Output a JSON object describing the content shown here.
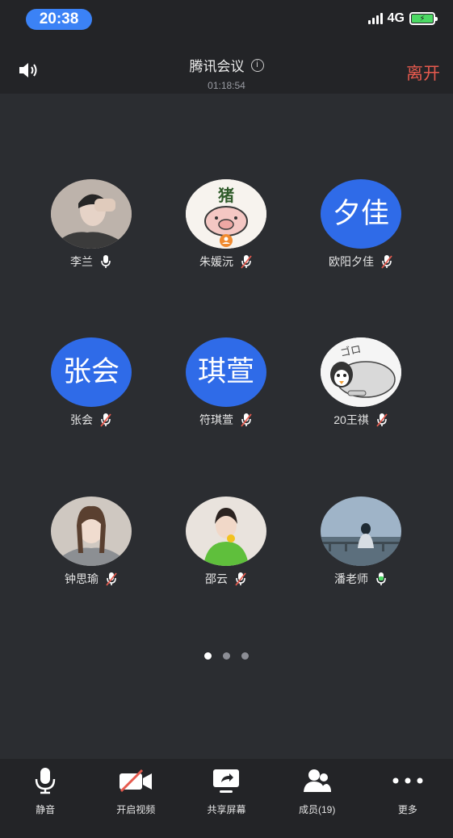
{
  "status": {
    "time": "20:38",
    "network": "4G"
  },
  "header": {
    "title": "腾讯会议",
    "duration": "01:18:54",
    "leave_label": "离开"
  },
  "members": [
    {
      "name": "李兰",
      "avatar_type": "photo",
      "mic": "on"
    },
    {
      "name": "朱媛沅",
      "avatar_type": "photo",
      "mic": "muted",
      "avatar_text": "猪"
    },
    {
      "name": "欧阳夕佳",
      "avatar_type": "text",
      "avatar_text": "夕佳",
      "mic": "muted"
    },
    {
      "name": "张会",
      "avatar_type": "text",
      "avatar_text": "张会",
      "mic": "muted"
    },
    {
      "name": "符琪萱",
      "avatar_type": "text",
      "avatar_text": "琪萱",
      "mic": "muted"
    },
    {
      "name": "20王祺",
      "avatar_type": "photo",
      "mic": "muted",
      "avatar_text": "ゴロ"
    },
    {
      "name": "钟思瑜",
      "avatar_type": "photo",
      "mic": "muted"
    },
    {
      "name": "邵云",
      "avatar_type": "photo",
      "mic": "muted"
    },
    {
      "name": "潘老师",
      "avatar_type": "photo",
      "mic": "active"
    }
  ],
  "toolbar": [
    {
      "label": "静音",
      "icon": "microphone-icon"
    },
    {
      "label": "开启视频",
      "icon": "video-off-icon"
    },
    {
      "label": "共享屏幕",
      "icon": "share-screen-icon"
    },
    {
      "label": "成员(19)",
      "icon": "members-icon"
    },
    {
      "label": "更多",
      "icon": "more-icon"
    }
  ],
  "colors": {
    "accent": "#2f6be8",
    "leave": "#e65a4e",
    "mic_active": "#4cd964",
    "mute_red": "#e65a4e"
  }
}
